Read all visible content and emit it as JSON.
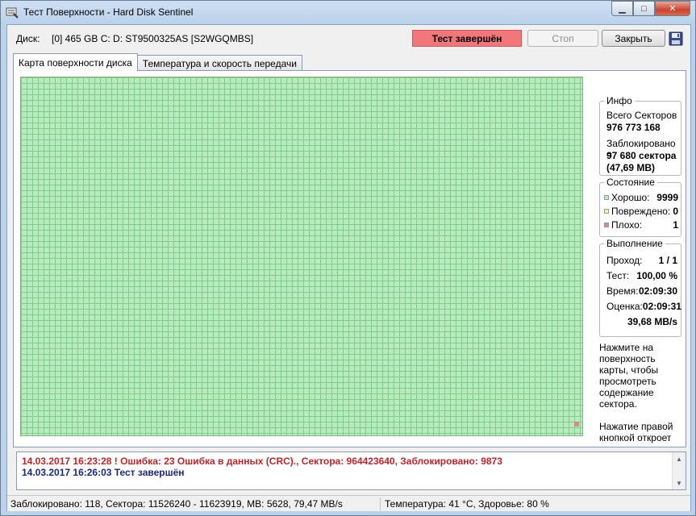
{
  "window": {
    "title": "Тест Поверхности - Hard Disk Sentinel",
    "icons": {
      "app": "disk-test-icon",
      "minimize": "minimize-icon",
      "maximize": "maximize-icon",
      "close": "close-icon"
    },
    "controls": {
      "minimize": "▁",
      "maximize": "□",
      "close": "✕"
    }
  },
  "toolbar": {
    "disk_label": "Диск:",
    "disk_value": "[0] 465 GB C: D: ST9500325AS [S2WGQMBS]",
    "status": "Тест завершён",
    "stop_label": "Стоп",
    "close_label": "Закрыть",
    "save_icon": "floppy-save-icon"
  },
  "tabs": [
    {
      "label": "Карта поверхности диска",
      "active": true
    },
    {
      "label": "Температура и скорость передачи",
      "active": false
    }
  ],
  "info": {
    "title": "Инфо",
    "total_sectors_label": "Всего Секторов",
    "total_sectors_value": "976 773 168",
    "blocked_label": "Заблокировано =",
    "blocked_value": "97 680 сектора",
    "blocked_size": "(47,69 MB)"
  },
  "state": {
    "title": "Состояние",
    "rows": [
      {
        "label": "Хорошо:",
        "value": "9999",
        "color": "#b6ecbe"
      },
      {
        "label": "Повреждено:",
        "value": "0",
        "color": "#f2f2b0"
      },
      {
        "label": "Плохо:",
        "value": "1",
        "color": "#d38a8a"
      }
    ]
  },
  "execution": {
    "title": "Выполнение",
    "pass_label": "Проход:",
    "pass_value": "1 / 1",
    "test_label": "Тест:",
    "test_value": "100,00 %",
    "time_label": "Время:",
    "time_value": "02:09:30",
    "estimate_label": "Оценка:",
    "estimate_value": "02:09:31",
    "speed_value": "39,68 MB/s"
  },
  "help_text": "Нажмите на поверхность карты, чтобы просмотреть содержание сектора.\n\nНажатие правой кнопкой откроет",
  "log": [
    {
      "text": "14.03.2017  16:23:28 ! Ошибка: 23 Ошибка в данных (CRC)., Сектора: 964423640, Заблокировано: 9873",
      "type": "error"
    },
    {
      "text": "14.03.2017  16:26:03   Тест завершён",
      "type": "info"
    }
  ],
  "statusbar": {
    "left": "Заблокировано: 118, Сектора: 11526240 - 11623919, MB: 5628, 79,47 MB/s",
    "right": "Температура: 41  °C,  Здоровье: 80 %"
  },
  "colors": {
    "status_bg": "#f2777a",
    "good": "#b6ecbe",
    "bad": "#d38a8a",
    "log_error": "#c0252c",
    "log_info": "#1a2a7c"
  }
}
